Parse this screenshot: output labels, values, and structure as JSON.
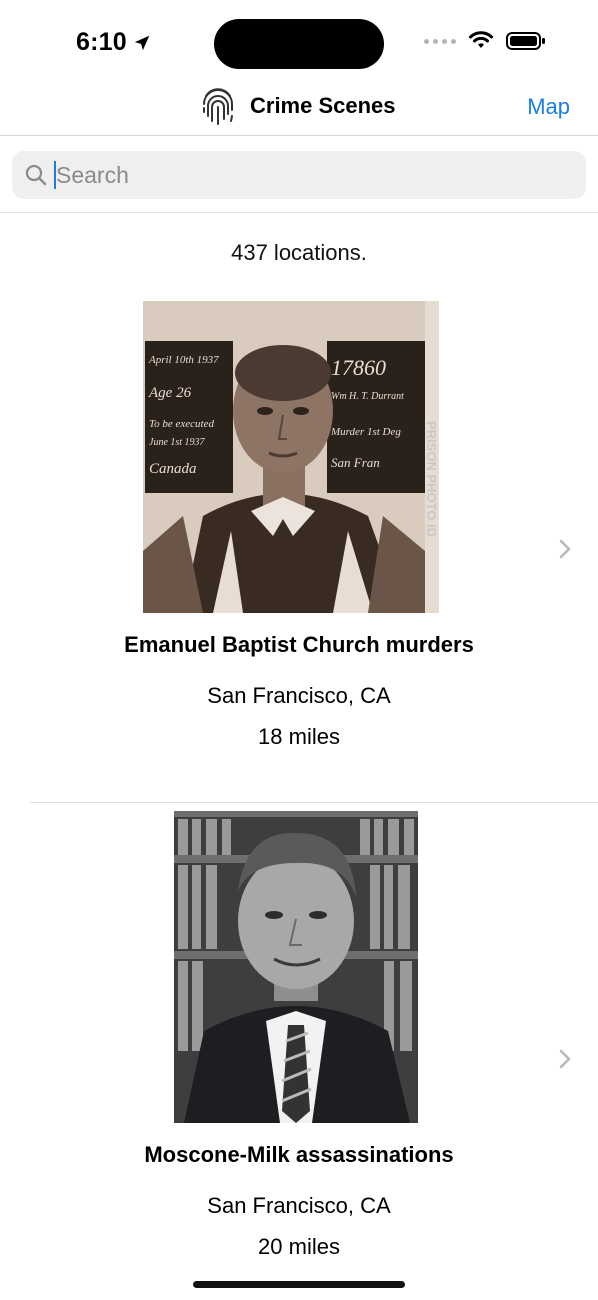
{
  "status_bar": {
    "time": "6:10"
  },
  "nav": {
    "title": "Crime Scenes",
    "map_label": "Map"
  },
  "search": {
    "placeholder": "Search",
    "value": ""
  },
  "count_text": "437 locations.",
  "items": [
    {
      "title": "Emanuel Baptist Church murders",
      "city": "San Francisco, CA",
      "distance": "18 miles",
      "photo": {
        "left_card_lines": [
          "April 10th 1937",
          "Age 26",
          "To be executed",
          "June 1st 1937",
          "Canada"
        ],
        "right_card_lines": [
          "17860",
          "Wm H. T. Durrant",
          "Murder 1st Deg",
          "San Fran"
        ],
        "watermark": "PRISON PHOTO ID"
      }
    },
    {
      "title": "Moscone-Milk assassinations",
      "city": "San Francisco, CA",
      "distance": "20 miles"
    }
  ],
  "colors": {
    "accent": "#1a7ee3",
    "search_bg": "#efefef",
    "placeholder": "#8a8a8e"
  }
}
